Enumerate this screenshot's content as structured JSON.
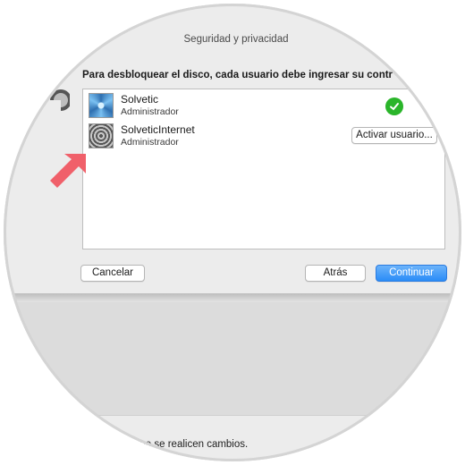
{
  "window": {
    "title": "Seguridad y privacidad"
  },
  "sheet": {
    "instruction": "Para desbloquear el disco, cada usuario debe ingresar su contr",
    "users": [
      {
        "name": "Solvetic",
        "role": "Administrador",
        "status": "enabled"
      },
      {
        "name": "SolveticInternet",
        "role": "Administrador",
        "action_label": "Activar usuario..."
      }
    ],
    "buttons": {
      "cancel": "Cancelar",
      "back": "Atrás",
      "continue": "Continuar"
    }
  },
  "footer": {
    "text": "que se realicen cambios."
  },
  "colors": {
    "accent": "#2a8cf7",
    "success": "#2ab52a",
    "arrow": "#f0606a"
  }
}
